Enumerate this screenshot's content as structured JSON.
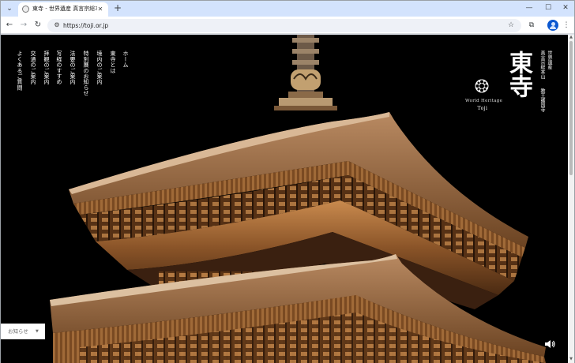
{
  "browser": {
    "tab": {
      "title": "東寺 - 世界遺産 真言宗総本山 教王護国寺"
    },
    "url": "https://toji.or.jp"
  },
  "menu": {
    "items": [
      "ホーム",
      "東寺とは",
      "境内のご案内",
      "特別展のお知らせ",
      "法要のご案内",
      "写経のすすめ",
      "拝観のご案内",
      "交通のご案内",
      "よくあるご質問"
    ]
  },
  "logo": {
    "world_heritage": "World Heritage",
    "name": "Toji",
    "mark": "東寺",
    "col1": "世界遺産",
    "col2": "真言宗総本山",
    "col3": "教王護国寺"
  },
  "news": {
    "label": "お知らせ"
  },
  "icons": {
    "menu": "chevron-down-icon",
    "sound": "speaker-icon",
    "emblem": "temple-crest-icon"
  }
}
